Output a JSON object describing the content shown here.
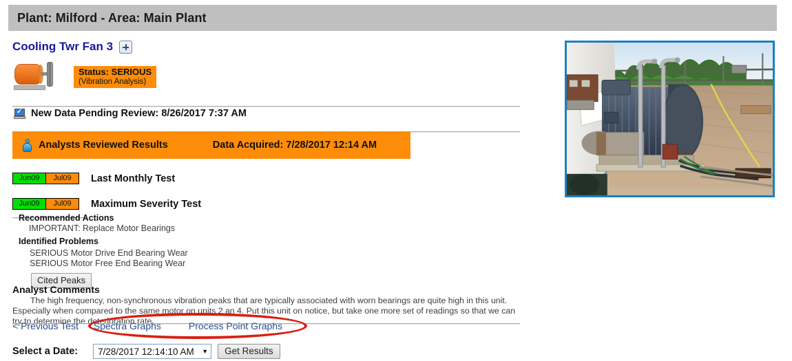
{
  "header": {
    "title": "Plant: Milford - Area: Main Plant"
  },
  "asset": {
    "name": "Cooling Twr Fan 3",
    "expand_icon": "plus-icon",
    "machine_icon": "motor-icon",
    "status_line1": "Status: SERIOUS",
    "status_line2": "(Vibration Analysis)"
  },
  "pending": {
    "icon": "monitor-check-icon",
    "text": "New Data Pending Review: 8/26/2017 7:37 AM"
  },
  "reviewed": {
    "icon": "analyst-person-icon",
    "label": "Analysts Reviewed Results",
    "acquired": "Data Acquired: 7/28/2017 12:14 AM"
  },
  "tests": [
    {
      "label": "Last Monthly Test",
      "cells": [
        {
          "text": "Jun09",
          "severity": "green"
        },
        {
          "text": "Jul09",
          "severity": "orange"
        }
      ]
    },
    {
      "label": "Maximum Severity Test",
      "cells": [
        {
          "text": "Jun09",
          "severity": "green"
        },
        {
          "text": "Jul09",
          "severity": "orange"
        }
      ]
    }
  ],
  "recommendations": {
    "heading": "Recommended Actions",
    "items": [
      "IMPORTANT: Replace Motor Bearings"
    ]
  },
  "problems": {
    "heading": "Identified Problems",
    "items": [
      "SERIOUS Motor Drive End Bearing Wear",
      "SERIOUS Motor Free End Bearing Wear"
    ],
    "cited_peaks_label": "Cited Peaks"
  },
  "comments": {
    "heading": "Analyst Comments",
    "body": "The high frequency, non-synchronous vibration peaks that are typically associated with worn bearings are quite high in this unit. Especially when compared to the same motor on units 2 an 4. Put this unit on notice, but take one more set of readings so that we can try to determine the deterioration rate."
  },
  "links": {
    "previous_test": "< Previous Test",
    "spectra_graphs": "Spectra Graphs",
    "process_point_graphs": "Process Point Graphs"
  },
  "date_selector": {
    "label": "Select a Date:",
    "value": "7/28/2017 12:14:10 AM",
    "caret_icon": "chevron-down-icon",
    "get_results_label": "Get Results"
  },
  "photo": {
    "alt": "Industrial electric motor on cooling tower deck",
    "border_color": "#1d7fc0"
  },
  "annotation": {
    "shape": "red-ellipse-highlight",
    "color": "#d81f10"
  },
  "colors": {
    "header_bar": "#bfbfbf",
    "status_orange": "#fd8c08",
    "severity_green": "#00e000",
    "title_blue": "#17189e",
    "link_blue": "#2b4f8e"
  }
}
